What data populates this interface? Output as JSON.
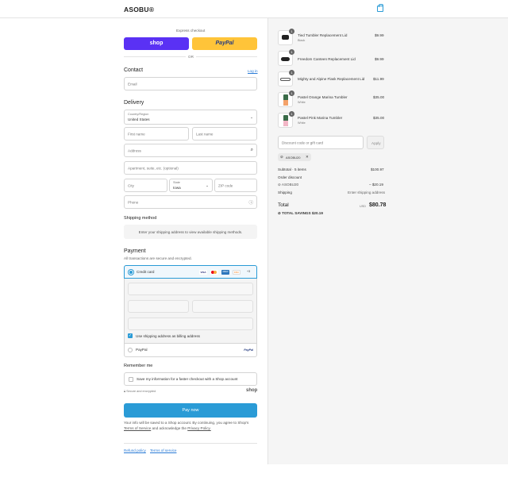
{
  "header": {
    "brand": "ASOBU®"
  },
  "express": {
    "title": "Express checkout",
    "shop": "shop",
    "paypal": "PayPal",
    "or": "OR"
  },
  "contact": {
    "title": "Contact",
    "login": "Log in",
    "email_ph": "Email"
  },
  "delivery": {
    "title": "Delivery",
    "country_label": "Country/Region",
    "country_value": "United States",
    "first_ph": "First name",
    "last_ph": "Last name",
    "address_ph": "Address",
    "apt_ph": "Apartment, suite, etc. (optional)",
    "city_ph": "City",
    "state_label": "State",
    "state_value": "Iowa",
    "zip_ph": "ZIP code",
    "phone_ph": "Phone"
  },
  "shipping": {
    "title": "Shipping method",
    "note": "Enter your shipping address to view available shipping methods."
  },
  "payment": {
    "title": "Payment",
    "subtitle": "All transactions are secure and encrypted.",
    "credit": "Credit card",
    "cards": [
      "VISA",
      "MC",
      "AMEX",
      "DISC"
    ],
    "more": "+3",
    "billing": "Use shipping address as billing address",
    "paypal": "PayPal",
    "paypal_logo": "PayPal"
  },
  "remember": {
    "title": "Remember me",
    "save": "Save my information for a faster checkout with a Shop account",
    "secure": "Secure and encrypted",
    "shop": "shop"
  },
  "pay": {
    "label": "Pay now",
    "legal1": "Your info will be saved to a Shop account. By continuing, you agree to Shop's",
    "tos": "Terms of Service",
    "legal2": "and acknowledge the",
    "privacy": "Privacy Policy."
  },
  "footer": {
    "refund": "Refund policy",
    "terms": "Terms of service"
  },
  "cart": {
    "items": [
      {
        "qty": "1",
        "name": "Tied Tumbler Replacement Lid",
        "variant": "Black",
        "price": "$9.99"
      },
      {
        "qty": "1",
        "name": "Freedom Canteen Replacement Lid",
        "variant": "",
        "price": "$9.99"
      },
      {
        "qty": "1",
        "name": "Mighty and Alpine Flask Replacement Lid",
        "variant": "",
        "price": "$11.99"
      },
      {
        "qty": "1",
        "name": "Pastel Orange Marina Tumbler",
        "variant": "White",
        "price": "$35.00"
      },
      {
        "qty": "1",
        "name": "Pastel Pink Marina Tumbler",
        "variant": "White",
        "price": "$35.00"
      }
    ],
    "discount_ph": "Discount code or gift card",
    "apply": "Apply",
    "code": "ASOBU20",
    "subtotal_label": "Subtotal · 5 items",
    "subtotal": "$100.97",
    "order_discount": "Order discount",
    "discount_code": "ASOBU20",
    "discount_value": "– $20.19",
    "shipping_label": "Shipping",
    "shipping_value": "Enter shipping address",
    "total_label": "Total",
    "currency": "USD",
    "total": "$80.78",
    "savings_label": "TOTAL SAVINGS",
    "savings": "$20.19"
  }
}
